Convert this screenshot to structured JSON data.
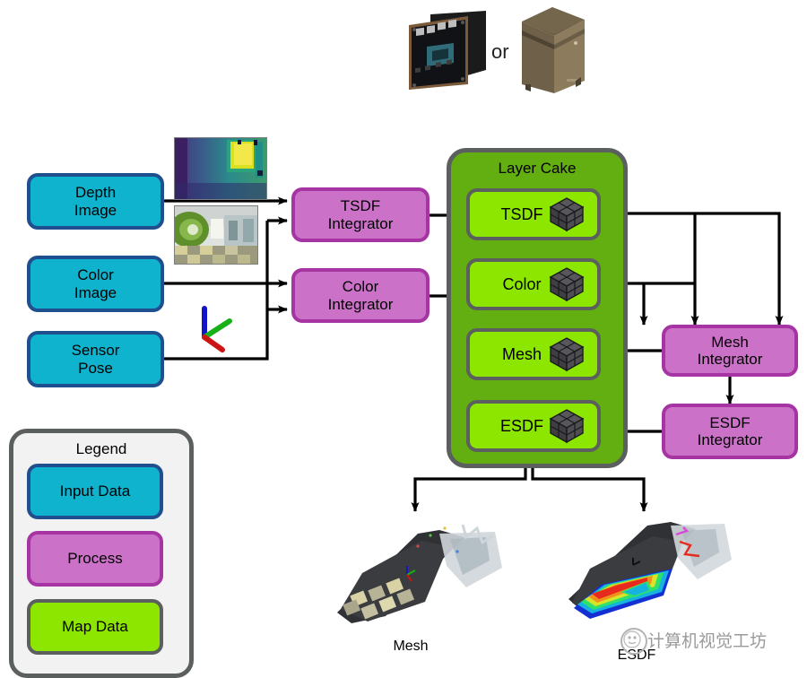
{
  "diagram": {
    "title_layer_cake": "Layer Cake",
    "hardware": {
      "or_label": "or",
      "devices": [
        "jetson-module-image",
        "desktop-tower-image"
      ]
    },
    "inputs": [
      {
        "name": "depth-image",
        "line1": "Depth",
        "line2": "Image"
      },
      {
        "name": "color-image",
        "line1": "Color",
        "line2": "Image"
      },
      {
        "name": "sensor-pose",
        "line1": "Sensor",
        "line2": "Pose"
      }
    ],
    "processes_left": [
      {
        "name": "tsdf-integrator",
        "line1": "TSDF",
        "line2": "Integrator"
      },
      {
        "name": "color-integrator",
        "line1": "Color",
        "line2": "Integrator"
      }
    ],
    "processes_right": [
      {
        "name": "mesh-integrator",
        "line1": "Mesh",
        "line2": "Integrator"
      },
      {
        "name": "esdf-integrator",
        "line1": "ESDF",
        "line2": "Integrator"
      }
    ],
    "map_layers": [
      {
        "name": "tsdf-layer",
        "label": "TSDF"
      },
      {
        "name": "color-layer",
        "label": "Color"
      },
      {
        "name": "mesh-layer",
        "label": "Mesh"
      },
      {
        "name": "esdf-layer",
        "label": "ESDF"
      }
    ],
    "outputs": [
      {
        "name": "mesh-output",
        "caption": "Mesh"
      },
      {
        "name": "esdf-output",
        "caption": "ESDF"
      }
    ],
    "thumbnails": [
      {
        "name": "depth-thumbnail"
      },
      {
        "name": "color-thumbnail"
      },
      {
        "name": "pose-axes-thumbnail"
      }
    ],
    "legend": {
      "title": "Legend",
      "items": [
        {
          "name": "legend-input-data",
          "label": "Input Data",
          "color": "#0fb3cd"
        },
        {
          "name": "legend-process",
          "label": "Process",
          "color": "#cb72c8"
        },
        {
          "name": "legend-map-data",
          "label": "Map Data",
          "color": "#8ce600"
        }
      ]
    },
    "watermark": {
      "text": "计算机视觉工坊"
    },
    "colors": {
      "input_fill": "#0fb3cd",
      "input_stroke": "#1f4f8f",
      "process_fill": "#cb72c8",
      "process_stroke": "#a634a3",
      "map_fill": "#8ce600",
      "map_stroke": "#5b5f5e",
      "cake_fill": "#63ae10",
      "legend_fill": "#f2f2f2",
      "wire": "#000000"
    }
  }
}
